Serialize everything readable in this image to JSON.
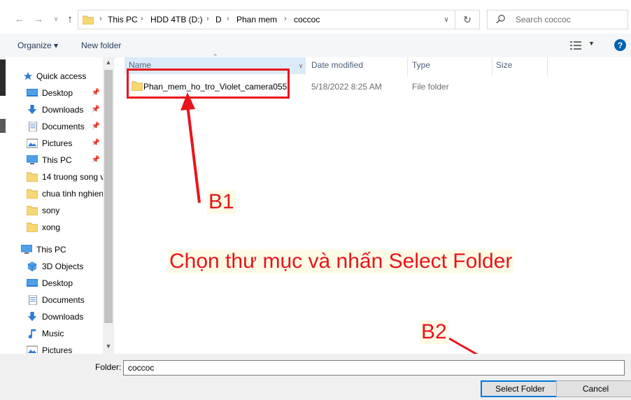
{
  "nav": {
    "back": "←",
    "forward": "→",
    "history": "∨",
    "up": "↑"
  },
  "address": {
    "crumbs": [
      "This PC",
      "HDD 4TB (D:)",
      "D",
      "Phan mem",
      "coccoc"
    ],
    "sep": "›"
  },
  "search": {
    "placeholder": "Search coccoc"
  },
  "toolbar": {
    "organize": "Organize ▾",
    "new_folder": "New folder",
    "help": "?"
  },
  "sidebar": {
    "quick_access": "Quick access",
    "quick_items": [
      "Desktop",
      "Downloads",
      "Documents",
      "Pictures",
      "This PC"
    ],
    "folders": [
      "14 truong song v",
      "chua tinh nghien",
      "sony",
      "xong"
    ],
    "this_pc": "This PC",
    "pc_items": [
      "3D Objects",
      "Desktop",
      "Documents",
      "Downloads",
      "Music",
      "Pictures"
    ],
    "pin": "📌"
  },
  "columns": {
    "name": "Name",
    "date": "Date modified",
    "type": "Type",
    "size": "Size"
  },
  "files": [
    {
      "name": "Phan_mem_ho_tro_Violet_camera055",
      "date": "5/18/2022 8:25 AM",
      "type": "File folder",
      "size": ""
    }
  ],
  "annotations": {
    "b1": "B1",
    "b2": "B2",
    "instruction": "Chọn thư mục và nhấn Select Folder"
  },
  "footer": {
    "folder_label": "Folder:",
    "folder_value": "coccoc",
    "select_label": "Select Folder",
    "cancel_label": "Cancel"
  },
  "colors": {
    "accent": "#0078d7",
    "annotation": "#e8141c",
    "folder_yellow": "#f8d775"
  }
}
